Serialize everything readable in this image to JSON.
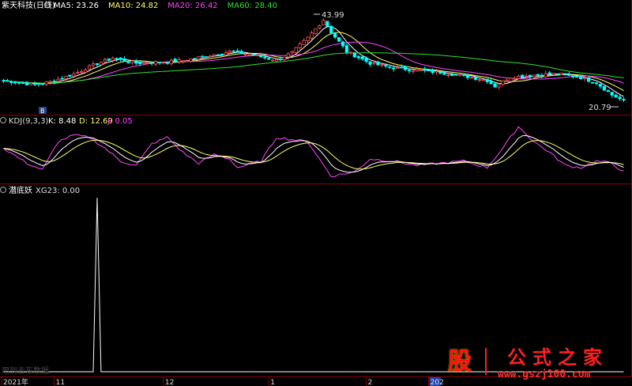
{
  "header": {
    "title": "紫天科技(日线)",
    "ma_legend": [
      {
        "label": "MA5: 23.26",
        "color": "#ffffff"
      },
      {
        "label": "MA10: 24.82",
        "color": "#ffff66"
      },
      {
        "label": "MA20: 26.42",
        "color": "#ff44ff"
      },
      {
        "label": "MA60: 28.40",
        "color": "#33dd33"
      }
    ]
  },
  "kdj_header": {
    "title": "KDJ(9,3,3)",
    "k": "K: 8.48",
    "d": "D: 12.69",
    "j": "J: 0.05",
    "colors": {
      "k": "#ffffff",
      "d": "#ffff66",
      "j": "#ff44ff"
    }
  },
  "ind_header": {
    "title": "潜底妖",
    "value": "XG23: 0.00"
  },
  "price": {
    "high_label": "43.99",
    "low_label": "20.79",
    "marker_label": "B"
  },
  "xaxis": {
    "labels": [
      "2021年",
      "11",
      "12",
      "1",
      "2",
      "202"
    ]
  },
  "watermark": {
    "glyph": "股",
    "name": "公式之家",
    "url": "www.gszj100.com",
    "faded": "用到去东数据"
  },
  "colors": {
    "up": "#ff5555",
    "down": "#00ffff",
    "grid": "#8b0000",
    "signal": "#ffffff"
  },
  "chart_data": {
    "type": "candlestick",
    "ylim": [
      18,
      46
    ],
    "n_bars": 160,
    "series": [
      {
        "name": "MA5",
        "role": "price_ma",
        "values": []
      },
      {
        "name": "MA10",
        "role": "price_ma",
        "values": []
      },
      {
        "name": "MA20",
        "role": "price_ma",
        "values": []
      },
      {
        "name": "MA60",
        "role": "price_ma",
        "values": []
      }
    ],
    "close_keypoints": [
      [
        0,
        26.8
      ],
      [
        8,
        25.6
      ],
      [
        12,
        26.4
      ],
      [
        18,
        28.6
      ],
      [
        24,
        31.5
      ],
      [
        28,
        33.0
      ],
      [
        34,
        31.6
      ],
      [
        40,
        31.9
      ],
      [
        46,
        32.3
      ],
      [
        52,
        33.6
      ],
      [
        58,
        34.8
      ],
      [
        64,
        33.8
      ],
      [
        70,
        32.4
      ],
      [
        74,
        34.5
      ],
      [
        78,
        38.6
      ],
      [
        82,
        43.6
      ],
      [
        84,
        40.2
      ],
      [
        88,
        34.8
      ],
      [
        94,
        31.6
      ],
      [
        100,
        30.3
      ],
      [
        106,
        29.7
      ],
      [
        112,
        29.0
      ],
      [
        118,
        28.1
      ],
      [
        124,
        26.8
      ],
      [
        126,
        25.2
      ],
      [
        130,
        27.7
      ],
      [
        136,
        28.3
      ],
      [
        142,
        28.7
      ],
      [
        148,
        27.6
      ],
      [
        152,
        26.2
      ],
      [
        156,
        22.8
      ],
      [
        159,
        21.2
      ]
    ],
    "kdj": {
      "j_keypoints": [
        [
          0,
          70
        ],
        [
          6,
          35
        ],
        [
          10,
          20
        ],
        [
          14,
          85
        ],
        [
          18,
          100
        ],
        [
          22,
          95
        ],
        [
          26,
          70
        ],
        [
          30,
          40
        ],
        [
          34,
          30
        ],
        [
          38,
          80
        ],
        [
          42,
          95
        ],
        [
          46,
          60
        ],
        [
          50,
          35
        ],
        [
          54,
          55
        ],
        [
          58,
          45
        ],
        [
          60,
          25
        ],
        [
          66,
          40
        ],
        [
          70,
          95
        ],
        [
          74,
          90
        ],
        [
          78,
          85
        ],
        [
          84,
          5
        ],
        [
          90,
          15
        ],
        [
          94,
          45
        ],
        [
          100,
          40
        ],
        [
          106,
          30
        ],
        [
          112,
          35
        ],
        [
          118,
          40
        ],
        [
          124,
          25
        ],
        [
          128,
          70
        ],
        [
          132,
          120
        ],
        [
          136,
          85
        ],
        [
          140,
          60
        ],
        [
          144,
          30
        ],
        [
          148,
          25
        ],
        [
          152,
          40
        ],
        [
          156,
          35
        ],
        [
          159,
          15
        ]
      ],
      "k": 8.48,
      "d": 12.69,
      "j": 0.05
    },
    "signal": {
      "name": "XG23",
      "spike_bars": [
        24
      ],
      "spike_value": 1,
      "value": 0
    }
  }
}
